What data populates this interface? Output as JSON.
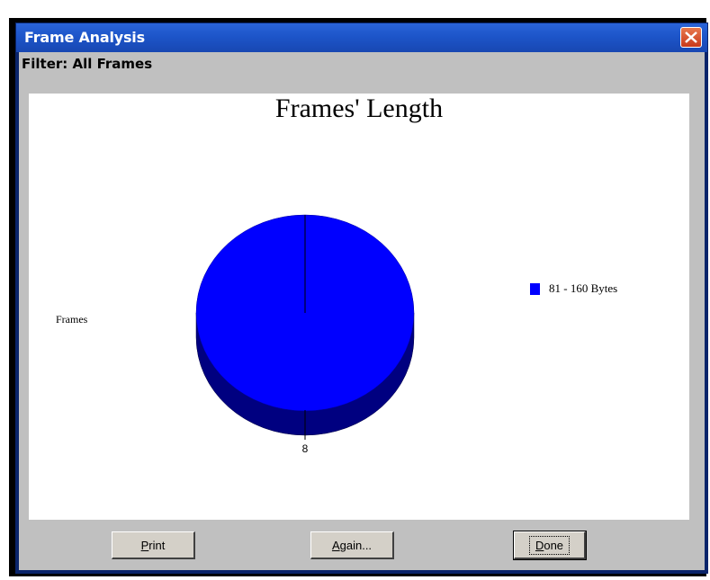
{
  "window": {
    "title": "Frame Analysis"
  },
  "filter": {
    "label": "Filter: All Frames"
  },
  "chart_data": {
    "type": "pie",
    "title": "Frames' Length",
    "ylabel": "Frames",
    "categories": [
      "81 - 160 Bytes"
    ],
    "values": [
      8
    ],
    "data_labels": [
      "8"
    ],
    "colors": [
      "#0000ff"
    ],
    "legend": "right"
  },
  "buttons": {
    "print_first": "P",
    "print_rest": "rint",
    "again_first": "A",
    "again_rest": "gain...",
    "done_first": "D",
    "done_rest": "one"
  },
  "colors": {
    "titlebar": "#1d55c9",
    "client_bg": "#c0c0c0",
    "pie_top": "#0000ff",
    "pie_side": "#000080"
  }
}
